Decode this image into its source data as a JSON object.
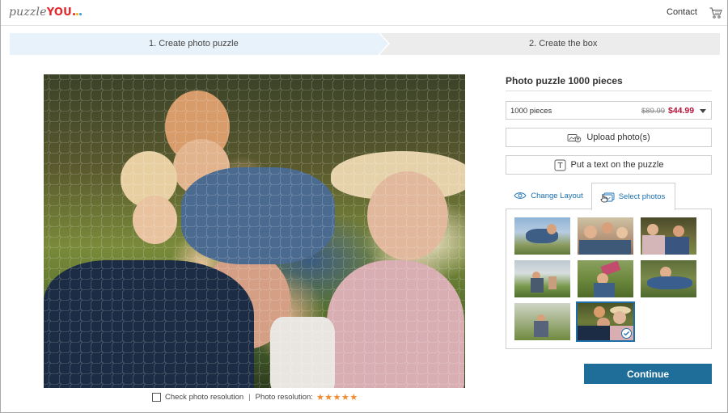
{
  "header": {
    "logo_text": "puzzle",
    "logo_brand": "YOU",
    "contact_label": "Contact"
  },
  "steps": [
    {
      "label": "1. Create photo puzzle",
      "active": true
    },
    {
      "label": "2. Create the box",
      "active": false
    }
  ],
  "canvas": {
    "check_label": "Check photo resolution",
    "separator": "|",
    "resolution_label": "Photo resolution:",
    "stars": "★★★★★",
    "rating": 5
  },
  "panel": {
    "title": "Photo puzzle 1000 pieces",
    "pieces_select": {
      "label": "1000 pieces",
      "old_price": "$89.99",
      "new_price": "$44.99"
    },
    "upload_label": "Upload photo(s)",
    "text_label": "Put a text on the puzzle",
    "tabs": [
      {
        "label": "Change Layout",
        "active": false
      },
      {
        "label": "Select photos",
        "active": true
      }
    ],
    "continue_label": "Continue"
  },
  "colors": {
    "accent": "#1f6e9a",
    "price": "#b3123b",
    "star": "#f28a2e",
    "step_active": "#e8f2fb",
    "step_inactive": "#ececec"
  }
}
